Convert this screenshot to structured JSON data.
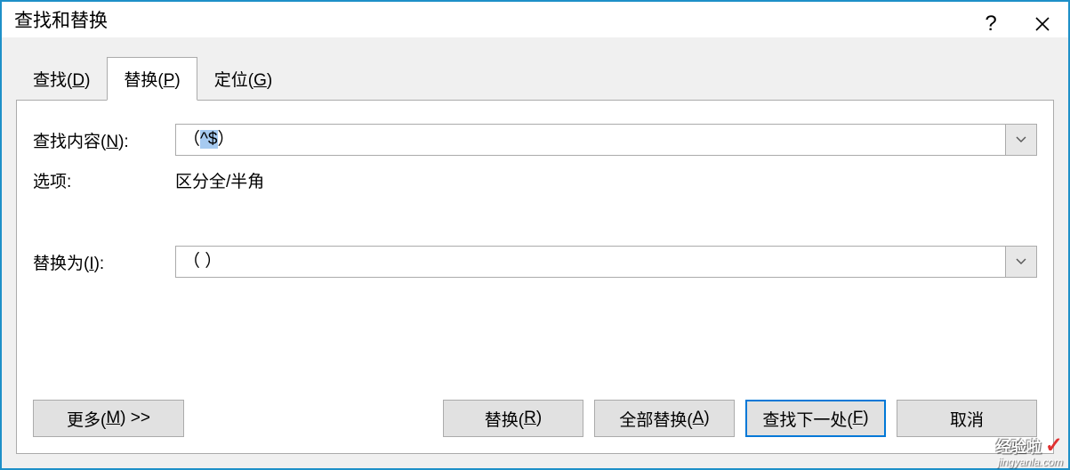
{
  "window": {
    "title": "查找和替换"
  },
  "tabs": {
    "find": {
      "label_pre": "查找(",
      "accel": "D",
      "label_post": ")"
    },
    "replace": {
      "label_pre": "替换(",
      "accel": "P",
      "label_post": ")"
    },
    "goto": {
      "label_pre": "定位(",
      "accel": "G",
      "label_post": ")"
    },
    "active": "replace"
  },
  "form": {
    "find_label_pre": "查找内容(",
    "find_accel": "N",
    "find_label_post": "):",
    "find_value_pre": "（",
    "find_value_sel": "^$",
    "find_value_post": "）",
    "options_label": "选项:",
    "options_value": "区分全/半角",
    "replace_label_pre": "替换为(",
    "replace_accel": "I",
    "replace_label_post": "):",
    "replace_value": "（ ）"
  },
  "buttons": {
    "more_pre": "更多(",
    "more_accel": "M",
    "more_post": ") >>",
    "replace_pre": "替换(",
    "replace_accel": "R",
    "replace_post": ")",
    "replace_all_pre": "全部替换(",
    "replace_all_accel": "A",
    "replace_all_post": ")",
    "find_next_pre": "查找下一处(",
    "find_next_accel": "F",
    "find_next_post": ")",
    "cancel": "取消"
  },
  "watermark": {
    "line1": "经验啦",
    "line2": "jingyanla.com",
    "check": "✓"
  }
}
